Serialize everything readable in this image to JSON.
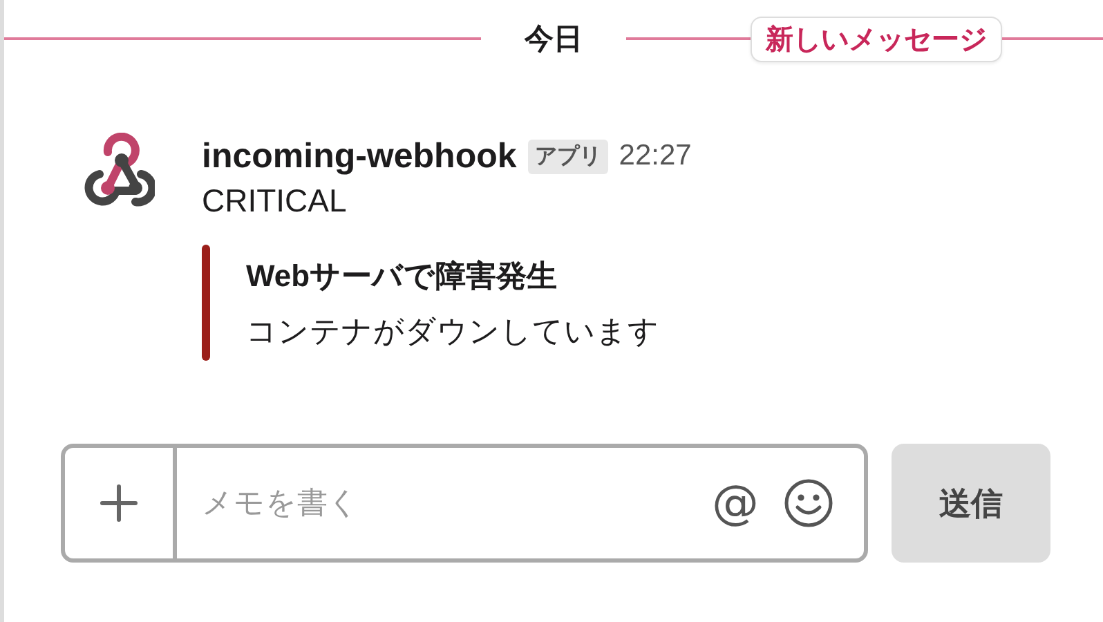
{
  "divider": {
    "label": "今日",
    "new_badge": "新しいメッセージ"
  },
  "message": {
    "sender": "incoming-webhook",
    "badge": "アプリ",
    "time": "22:27",
    "text": "CRITICAL",
    "attachment": {
      "color": "#9b1f1a",
      "title": "Webサーバで障害発生",
      "text": "コンテナがダウンしています"
    }
  },
  "composer": {
    "placeholder": "メモを書く",
    "mention": "@",
    "send": "送信"
  }
}
